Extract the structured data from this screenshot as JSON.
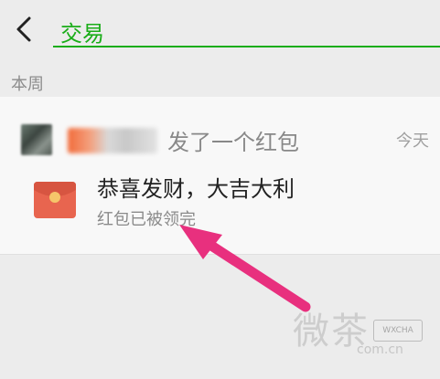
{
  "header": {
    "search_value": "交易"
  },
  "section": {
    "label": "本周"
  },
  "item": {
    "action": "发了一个红包",
    "time": "今天",
    "blessing": "恭喜发财，大吉大利",
    "status": "红包已被领完"
  },
  "watermark": {
    "badge": "WXCHA",
    "small": "com.cn"
  },
  "colors": {
    "accent": "#1aad19",
    "arrow": "#e8307e",
    "envelope": "#e8654f"
  },
  "icons": {
    "back": "chevron-left-icon",
    "envelope": "red-envelope-icon"
  }
}
